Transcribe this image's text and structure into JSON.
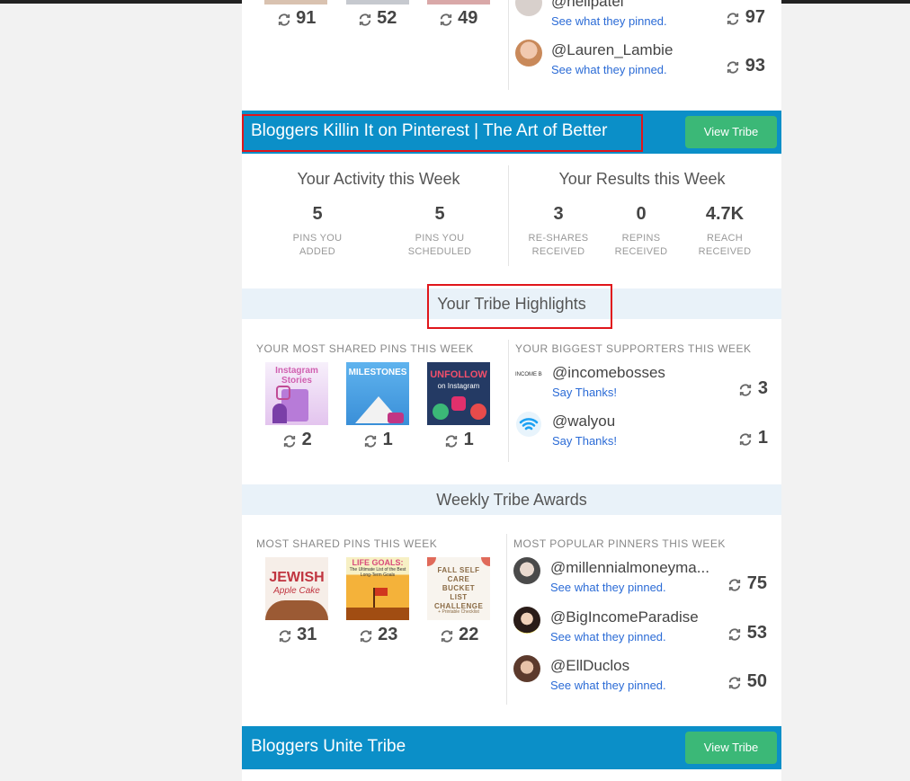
{
  "previous": {
    "pin_counts": [
      "91",
      "52",
      "49"
    ],
    "pinners": [
      {
        "handle": "@nellpatel",
        "link": "See what they pinned.",
        "count": "97"
      },
      {
        "handle": "@Lauren_Lambie",
        "link": "See what they pinned.",
        "count": "93"
      }
    ]
  },
  "tribe1": {
    "title": "Bloggers Killin It on Pinterest | The Art of Better",
    "view_label": "View Tribe",
    "activity_title": "Your Activity this Week",
    "results_title": "Your Results this Week",
    "activity": [
      {
        "value": "5",
        "line1": "PINS YOU",
        "line2": "ADDED"
      },
      {
        "value": "5",
        "line1": "PINS YOU",
        "line2": "SCHEDULED"
      }
    ],
    "results": [
      {
        "value": "3",
        "line1": "RE-SHARES",
        "line2": "RECEIVED"
      },
      {
        "value": "0",
        "line1": "REPINS",
        "line2": "RECEIVED"
      },
      {
        "value": "4.7K",
        "line1": "REACH",
        "line2": "RECEIVED"
      }
    ],
    "highlights_title": "Your Tribe Highlights",
    "shared_label": "YOUR MOST SHARED PINS THIS WEEK",
    "supporters_label": "YOUR BIGGEST SUPPORTERS THIS WEEK",
    "shared_pins": [
      {
        "count": "2",
        "text": "Instagram Stories"
      },
      {
        "count": "1",
        "text": "MILESTONES"
      },
      {
        "count": "1",
        "text": "UNFOLLOW",
        "text2": "on Instagram"
      }
    ],
    "supporters": [
      {
        "handle": "@incomebosses",
        "link": "Say Thanks!",
        "count": "3",
        "logo": "INCOME Bosses"
      },
      {
        "handle": "@walyou",
        "link": "Say Thanks!",
        "count": "1"
      }
    ],
    "awards_title": "Weekly Tribe Awards",
    "awards_shared_label": "MOST SHARED PINS THIS WEEK",
    "awards_pinners_label": "MOST POPULAR PINNERS THIS WEEK",
    "award_pins": [
      {
        "count": "31",
        "text": "JEWISH",
        "text2": "Apple Cake"
      },
      {
        "count": "23",
        "text": "LIFE GOALS:",
        "text2": "The Ultimate List of the Best Long-Term Goals"
      },
      {
        "count": "22",
        "text": "FALL SELF CARE BUCKET LIST CHALLENGE",
        "text2": "+ Printable Checklist"
      }
    ],
    "award_pinners": [
      {
        "handle": "@millennialmoneyma...",
        "link": "See what they pinned.",
        "count": "75"
      },
      {
        "handle": "@BigIncomeParadise",
        "link": "See what they pinned.",
        "count": "53"
      },
      {
        "handle": "@EllDuclos",
        "link": "See what they pinned.",
        "count": "50"
      }
    ]
  },
  "tribe2": {
    "title": "Bloggers Unite Tribe",
    "view_label": "View Tribe"
  },
  "colors": {
    "tribe_bar": "#0b8fc8",
    "button": "#3bb877",
    "link": "#2b6bd6",
    "highlight_box": "#e0161b",
    "section_head": "#e9f2f9"
  }
}
